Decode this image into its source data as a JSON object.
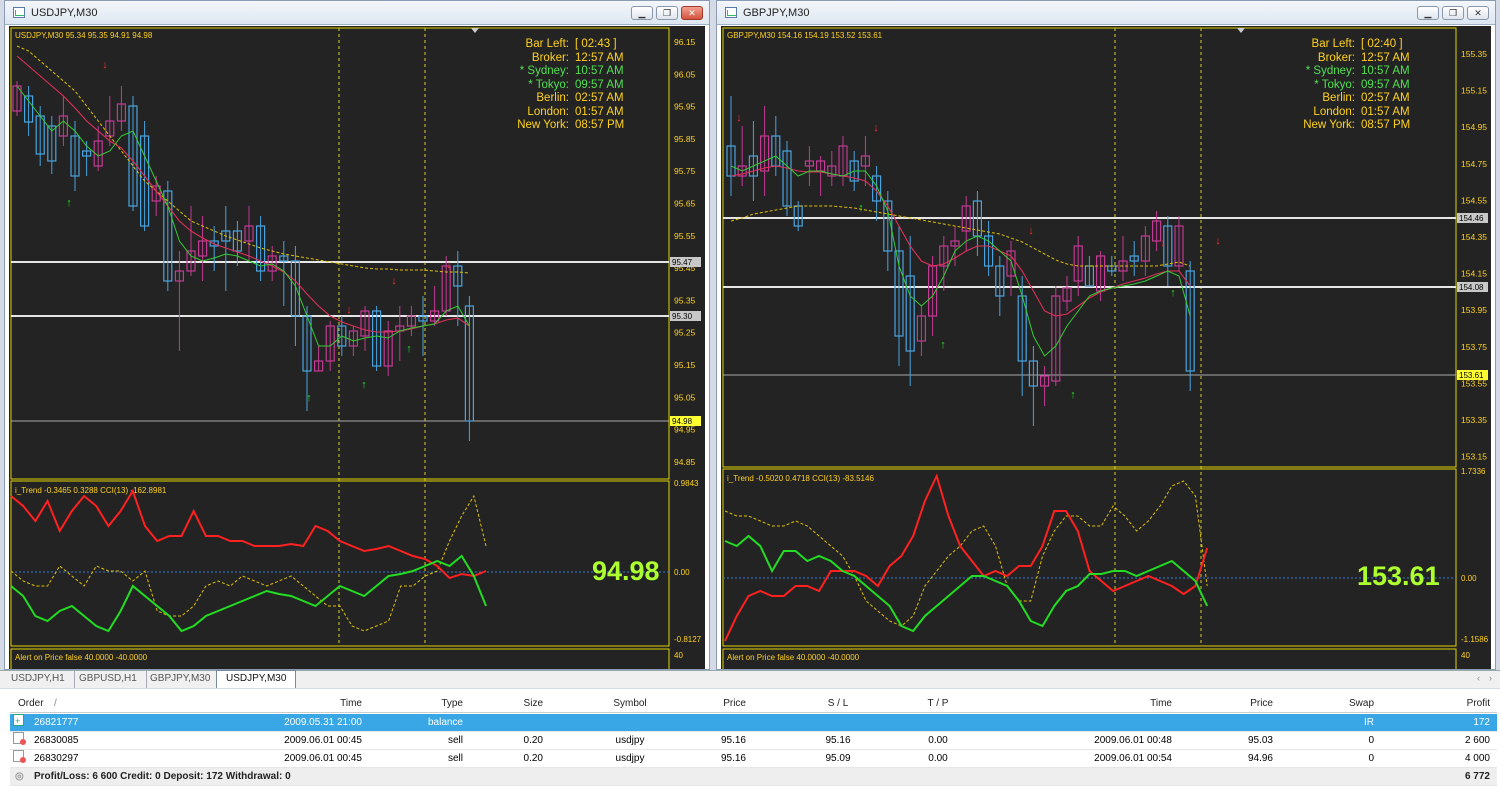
{
  "windows": [
    {
      "id": "w1",
      "title": "USDJPY,M30",
      "header": "USDJPY,M30  95.34 95.35 94.91 94.98",
      "price_axis": [
        "96.15",
        "96.05",
        "95.95",
        "95.85",
        "95.75",
        "95.65",
        "95.55",
        "95.45",
        "95.35",
        "95.25",
        "95.15",
        "95.05",
        "94.95",
        "94.85"
      ],
      "hline_tags": [
        "95.47",
        "95.30"
      ],
      "current_price_tag": "94.98",
      "indicator_label": "i_Trend -0.3465 0.3288  CCI(13) -162.8981",
      "indicator_axis": [
        "0.9843",
        "0.00",
        "-0.8127"
      ],
      "big_price": "94.98",
      "alert_label": "Alert on Price false  40.0000 -40.0000",
      "alert_axis": "40",
      "clock": [
        [
          "Bar Left:",
          "[ 02:43 ]"
        ],
        [
          "Broker:",
          "12:57 AM"
        ],
        [
          "* Sydney:",
          "10:57 AM"
        ],
        [
          "* Tokyo:",
          "09:57 AM"
        ],
        [
          "Berlin:",
          "02:57 AM"
        ],
        [
          "London:",
          "01:57 AM"
        ],
        [
          "New York:",
          "08:57 PM"
        ]
      ]
    },
    {
      "id": "w2",
      "title": "GBPJPY,M30",
      "header": "GBPJPY,M30  154.16 154.19 153.52 153.61",
      "price_axis": [
        "155.35",
        "155.15",
        "154.95",
        "154.75",
        "154.55",
        "154.35",
        "154.15",
        "153.95",
        "153.75",
        "153.55",
        "153.35",
        "153.15"
      ],
      "hline_tags": [
        "154.46",
        "154.08"
      ],
      "current_price_tag": "153.61",
      "indicator_label": "i_Trend -0.5020 0.4718  CCI(13) -83.5146",
      "indicator_axis": [
        "1.7336",
        "0.00",
        "-1.1586"
      ],
      "big_price": "153.61",
      "alert_label": "Alert on Price false  40.0000 -40.0000",
      "alert_axis": "40",
      "clock": [
        [
          "Bar Left:",
          "[ 02:40 ]"
        ],
        [
          "Broker:",
          "12:57 AM"
        ],
        [
          "* Sydney:",
          "10:57 AM"
        ],
        [
          "* Tokyo:",
          "09:57 AM"
        ],
        [
          "Berlin:",
          "02:57 AM"
        ],
        [
          "London:",
          "01:57 AM"
        ],
        [
          "New York:",
          "08:57 PM"
        ]
      ]
    }
  ],
  "colors": {
    "bull": "#4aa3e0",
    "bear": "#c23a93",
    "clock_key": "#ffd21f",
    "clock_green": "#52e052",
    "big_price": "#adff2f",
    "bg": "#232323"
  },
  "tabs": [
    "USDJPY,H1",
    "GBPUSD,H1",
    "GBPJPY,M30",
    "USDJPY,M30"
  ],
  "active_tab": "USDJPY,M30",
  "orders": {
    "columns": [
      "Order",
      "/",
      "Time",
      "Type",
      "Size",
      "Symbol",
      "Price",
      "S / L",
      "T / P",
      "Time",
      "Price",
      "Swap",
      "Profit"
    ],
    "rows": [
      [
        "26821777",
        "2009.05.31 21:00",
        "balance",
        "",
        "",
        "",
        "",
        "",
        "",
        "",
        "IR",
        "172"
      ],
      [
        "26830085",
        "2009.06.01 00:45",
        "sell",
        "0.20",
        "usdjpy",
        "95.16",
        "95.16",
        "0.00",
        "2009.06.01 00:48",
        "95.03",
        "0",
        "2 600"
      ],
      [
        "26830297",
        "2009.06.01 00:45",
        "sell",
        "0.20",
        "usdjpy",
        "95.16",
        "95.09",
        "0.00",
        "2009.06.01 00:54",
        "94.96",
        "0",
        "4 000"
      ]
    ],
    "totals_label": "Profit/Loss: 6 600  Credit: 0  Deposit: 172  Withdrawal: 0",
    "totals_value": "6 772"
  },
  "icons": [
    "chart-window-icon",
    "minimize-icon",
    "restore-icon",
    "close-icon",
    "balance-icon",
    "order-icon",
    "up-arrow-icon",
    "down-arrow-icon"
  ]
}
